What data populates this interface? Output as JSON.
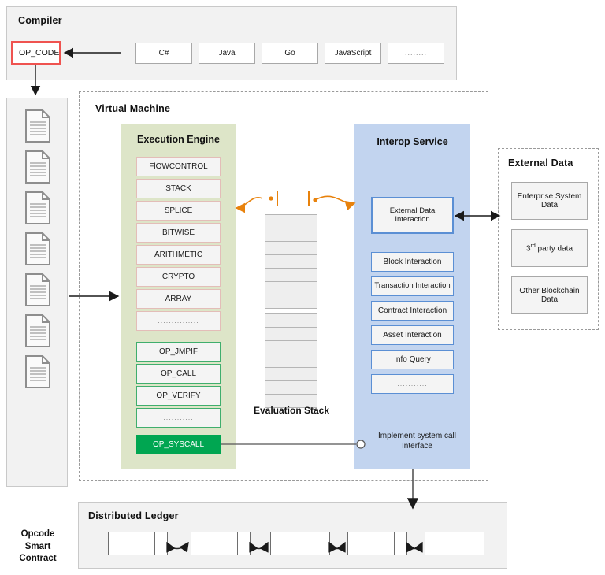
{
  "compiler": {
    "title": "Compiler",
    "opcode_box": "OP_CODE",
    "languages": [
      "C#",
      "Java",
      "Go",
      "JavaScript",
      "........"
    ]
  },
  "opcode_column": {
    "caption_line1": "Opcode",
    "caption_line2": "Smart",
    "caption_line3": "Contract",
    "document_count": 7,
    "icon": "document-icon"
  },
  "virtual_machine": {
    "title": "Virtual Machine",
    "execution_engine": {
      "title": "Execution Engine",
      "panel_color": "#dde5c8",
      "categories": [
        "FlOWCONTROL",
        "STACK",
        "SPLICE",
        "BITWISE",
        "ARITHMETIC",
        "CRYPTO",
        "ARRAY",
        "..............."
      ],
      "operations": [
        "OP_JMPIF",
        "OP_CALL",
        "OP_VERIFY",
        "..........."
      ],
      "syscall": "OP_SYSCALL",
      "syscall_color": "#00a651"
    },
    "evaluation_stack": {
      "label": "Evaluation Stack",
      "head_cells": 3,
      "group_one_cells": 7,
      "group_two_cells": 7,
      "accent_color": "#e8820c"
    },
    "interop_service": {
      "title": "Interop Service",
      "panel_color": "#c2d4ef",
      "primary_item": "External Data Interaction",
      "items": [
        "Block Interaction",
        "Transaction Interaction",
        "Contract Interaction",
        "Asset Interaction",
        "Info Query",
        "..........."
      ],
      "interface_label": "Implement system call Interface"
    }
  },
  "external_data": {
    "title": "External Data",
    "items": [
      "Enterprise System Data",
      "3rd party data",
      "Other Blockchain Data"
    ],
    "third_party": {
      "prefix": "3",
      "sup": "rd",
      "suffix": " party data"
    }
  },
  "distributed_ledger": {
    "title": "Distributed Ledger",
    "block_count": 5
  }
}
